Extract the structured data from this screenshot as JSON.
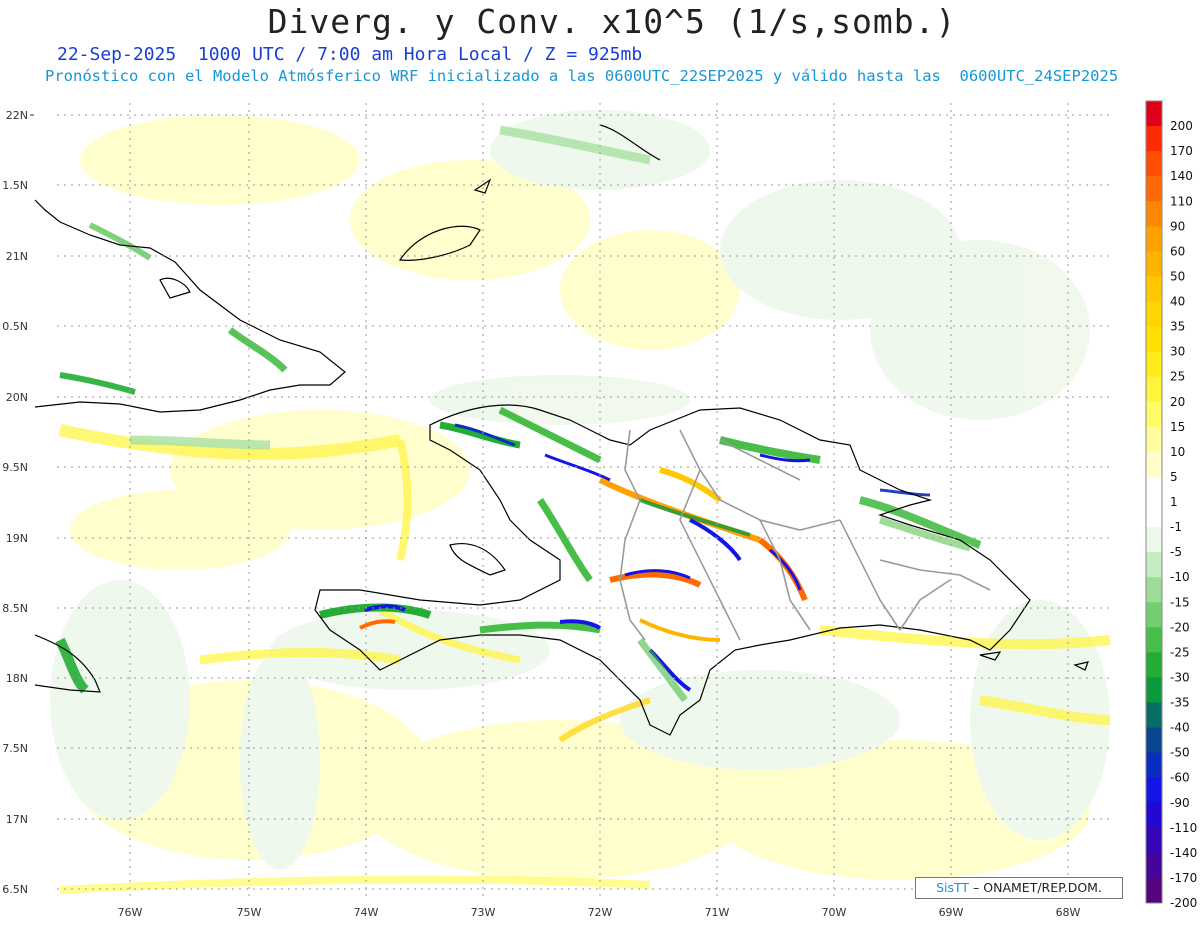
{
  "header": {
    "title": "Diverg. y Conv. x10^5 (1/s,somb.)",
    "subtitle_line1": "22-Sep-2025  1000 UTC / 7:00 am Hora Local / Z = 925mb",
    "subtitle_line2": "Pronóstico con el Modelo Atmósferico WRF inicializado a las 0600UTC_22SEP2025 y válido hasta las  0600UTC_24SEP2025"
  },
  "axes": {
    "lat_labels": [
      "22N",
      "1.5N",
      "21N",
      "0.5N",
      "20N",
      "9.5N",
      "19N",
      "8.5N",
      "18N",
      "7.5N",
      "17N",
      "6.5N"
    ],
    "lon_labels": [
      "76W",
      "75W",
      "74W",
      "73W",
      "72W",
      "71W",
      "70W",
      "69W",
      "68W"
    ]
  },
  "colorbar": {
    "labels": [
      "200",
      "170",
      "140",
      "110",
      "90",
      "60",
      "50",
      "40",
      "35",
      "30",
      "25",
      "20",
      "15",
      "10",
      "5",
      "1",
      "-1",
      "-5",
      "-10",
      "-15",
      "-20",
      "-25",
      "-30",
      "-35",
      "-40",
      "-50",
      "-60",
      "-90",
      "-110",
      "-140",
      "-170",
      "-200"
    ],
    "colors": [
      "#e0001a",
      "#ff2a00",
      "#ff4e00",
      "#ff6a00",
      "#ff8600",
      "#ffa100",
      "#ffb400",
      "#ffc800",
      "#ffd400",
      "#ffe000",
      "#ffea1a",
      "#fff53d",
      "#fffb66",
      "#fffd9e",
      "#fffec8",
      "#ffffff",
      "#ffffff",
      "#eef8ea",
      "#c6ecc3",
      "#9edd98",
      "#72ce6e",
      "#48bd48",
      "#23ad34",
      "#0b9a3a",
      "#076e66",
      "#08478f",
      "#0a2cc0",
      "#1414e6",
      "#2208d2",
      "#3406b6",
      "#44069a",
      "#54047e"
    ]
  },
  "credit": {
    "brand": "SisTT",
    "org": "– ONAMET/REP.DOM."
  }
}
